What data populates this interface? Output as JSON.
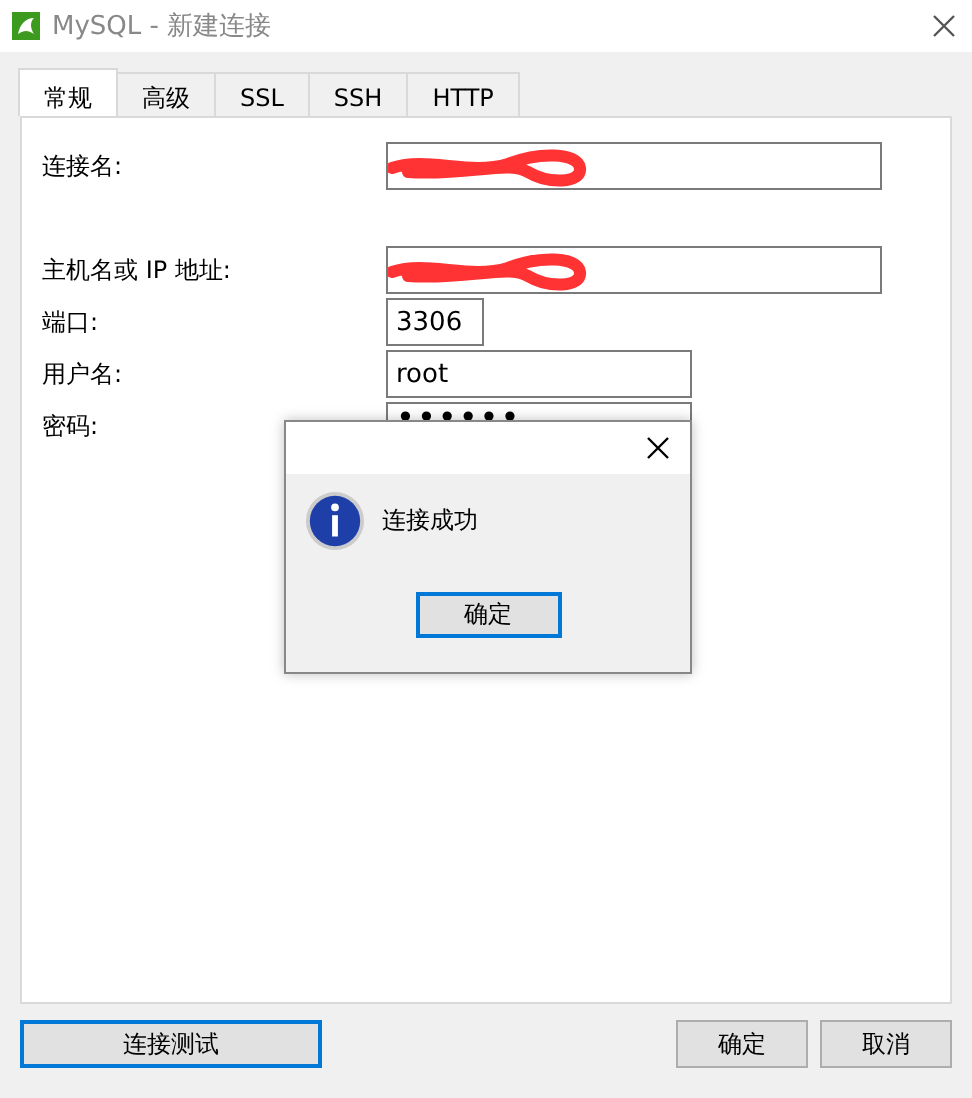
{
  "window": {
    "title": "MySQL - 新建连接"
  },
  "tabs": [
    {
      "label": "常规",
      "selected": true
    },
    {
      "label": "高级",
      "selected": false
    },
    {
      "label": "SSL",
      "selected": false
    },
    {
      "label": "SSH",
      "selected": false
    },
    {
      "label": "HTTP",
      "selected": false
    }
  ],
  "fields": [
    {
      "label": "连接名:",
      "kind": "redacted"
    },
    {
      "label": "主机名或 IP 地址:",
      "kind": "redacted"
    },
    {
      "label": "端口:",
      "kind": "text",
      "value": "3306"
    },
    {
      "label": "用户名:",
      "kind": "text",
      "value": "root"
    },
    {
      "label": "密码:",
      "kind": "password",
      "value": "••••••"
    }
  ],
  "buttons": {
    "test": "连接测试",
    "ok": "确定",
    "cancel": "取消"
  },
  "message_box": {
    "message": "连接成功",
    "button": "确定"
  }
}
